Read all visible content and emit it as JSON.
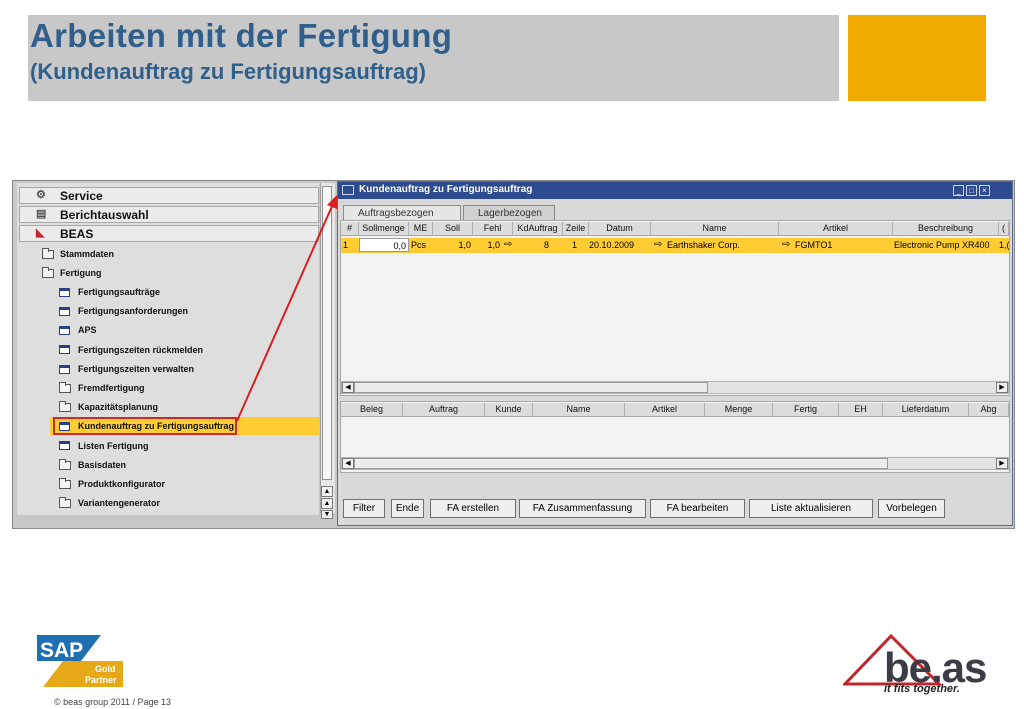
{
  "slide": {
    "title_line1": "Arbeiten mit der Fertigung",
    "title_line2": "(Kundenauftrag zu Fertigungsauftrag)",
    "accent_color": "#f0ab00",
    "title_color": "#2f5f8a"
  },
  "nav": {
    "bars": [
      {
        "label": "Service",
        "icon": "tools-icon"
      },
      {
        "label": "Berichtauswahl",
        "icon": "report-icon"
      },
      {
        "label": "BEAS",
        "icon": "beas-icon"
      }
    ],
    "folders": [
      {
        "label": "Stammdaten",
        "icon": "folder-icon"
      },
      {
        "label": "Fertigung",
        "icon": "folder-open-icon"
      }
    ],
    "items": [
      {
        "label": "Fertigungsaufträge",
        "icon": "form-icon"
      },
      {
        "label": "Fertigungsanforderungen",
        "icon": "form-icon"
      },
      {
        "label": "APS",
        "icon": "form-icon"
      },
      {
        "label": "Fertigungszeiten rückmelden",
        "icon": "form-icon"
      },
      {
        "label": "Fertigungszeiten verwalten",
        "icon": "form-icon"
      },
      {
        "label": "Fremdfertigung",
        "icon": "folder-icon"
      },
      {
        "label": "Kapazitätsplanung",
        "icon": "folder-icon"
      },
      {
        "label": "Kundenauftrag zu Fertigungsauftrag",
        "icon": "form-icon",
        "selected": true
      },
      {
        "label": "Listen Fertigung",
        "icon": "form-icon"
      },
      {
        "label": "Basisdaten",
        "icon": "folder-icon"
      },
      {
        "label": "Produktkonfigurator",
        "icon": "folder-icon"
      },
      {
        "label": "Variantengenerator",
        "icon": "folder-icon"
      }
    ]
  },
  "window": {
    "title": "Kundenauftrag zu Fertigungsauftrag",
    "tabs": [
      "Auftragsbezogen",
      "Lagerbezogen"
    ],
    "top_columns": [
      "#",
      "Sollmenge",
      "ME",
      "Soll",
      "Fehl",
      "KdAuftrag",
      "Zeile",
      "Datum",
      "Name",
      "Artikel",
      "Beschreibung",
      "("
    ],
    "top_rows": [
      {
        "num": "1",
        "sollmenge": "0,0",
        "me": "Pcs",
        "soll": "1,0",
        "fehl": "1,0",
        "kdauftrag": "8",
        "zeile": "1",
        "datum": "20.10.2009",
        "name": "Earthshaker Corp.",
        "artikel": "FGMTO1",
        "beschreibung": "Electronic Pump XR400",
        "extra": "1,("
      }
    ],
    "bottom_columns": [
      "Beleg",
      "Auftrag",
      "Kunde",
      "Name",
      "Artikel",
      "Menge",
      "Fertig",
      "EH",
      "Lieferdatum",
      "Abg"
    ],
    "buttons": [
      "Filter",
      "Ende",
      "FA erstellen",
      "FA Zusammenfassung",
      "FA bearbeiten",
      "Liste aktualisieren",
      "Vorbelegen"
    ],
    "highlight_color": "#ffcc33"
  },
  "footer": {
    "copyright": "© beas group 2011 / Page 13",
    "sap_logo_text": "SAP",
    "sap_badge_line1": "Gold",
    "sap_badge_line2": "Partner",
    "beas_logo": "be.as",
    "beas_tagline": "it fits together."
  }
}
